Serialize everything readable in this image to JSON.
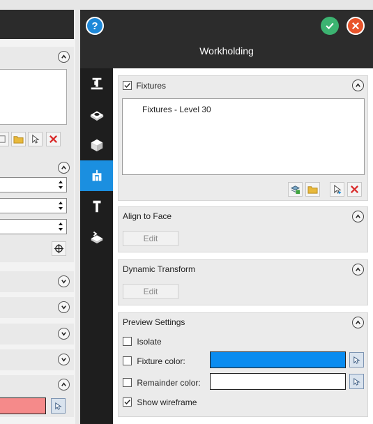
{
  "window": {
    "title": "Workholding"
  },
  "colors": {
    "accent": "#1b8fe0",
    "fixture_color": "#0a8cf0",
    "remainder_color": "#ffffff",
    "left_color_value": "#f58a8a",
    "ok": "#3cb371",
    "close": "#e8542b",
    "help": "#1e88d8"
  },
  "header": {
    "help_icon": "help-icon",
    "ok_icon": "check-icon",
    "close_icon": "close-icon"
  },
  "rail": {
    "items": [
      {
        "icon": "stock-icon"
      },
      {
        "icon": "fixture-shape-icon"
      },
      {
        "icon": "solid-box-icon"
      },
      {
        "icon": "workholding-icon",
        "active": true
      },
      {
        "icon": "tool-holder-icon"
      },
      {
        "icon": "transform-icon"
      }
    ]
  },
  "fixtures": {
    "label": "Fixtures",
    "checked": true,
    "items": [
      "Fixtures - Level 30"
    ],
    "tools": [
      "add-stack-icon",
      "open-folder-icon",
      "select-add-icon",
      "delete-icon"
    ]
  },
  "align_to_face": {
    "label": "Align to Face",
    "edit_label": "Edit"
  },
  "dynamic_transform": {
    "label": "Dynamic Transform",
    "edit_label": "Edit"
  },
  "preview": {
    "label": "Preview Settings",
    "isolate": {
      "label": "Isolate",
      "checked": false
    },
    "fixture_color": {
      "label": "Fixture color:",
      "checked": false
    },
    "remainder_color": {
      "label": "Remainder color:",
      "checked": false
    },
    "show_wireframe": {
      "label": "Show wireframe",
      "checked": true
    }
  }
}
